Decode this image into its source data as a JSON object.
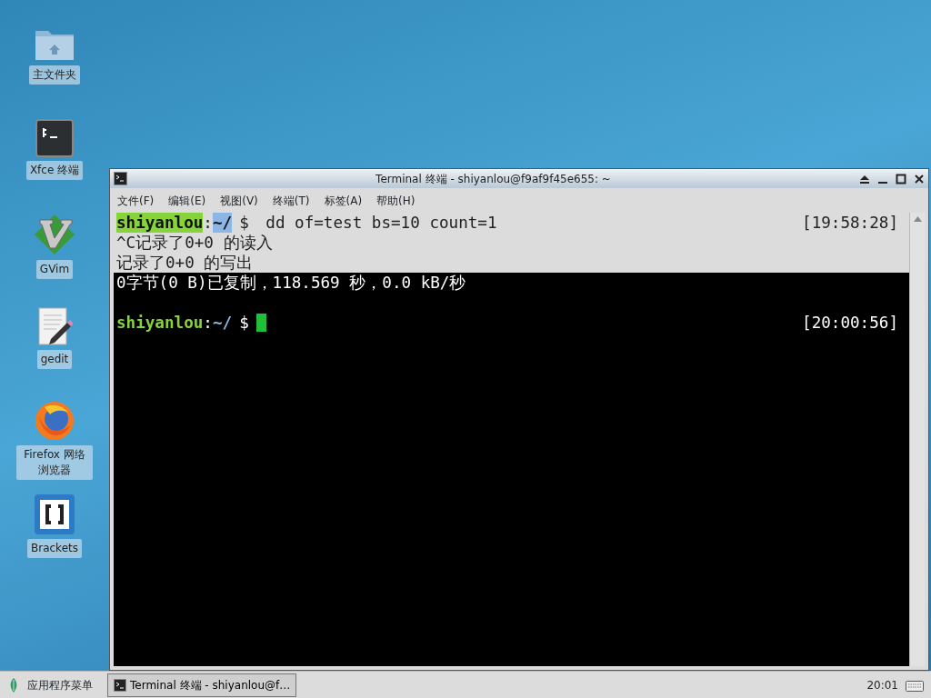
{
  "desktop_icons": [
    {
      "kind": "folder",
      "label": "主文件夹"
    },
    {
      "kind": "terminal",
      "label": "Xfce 终端"
    },
    {
      "kind": "vim",
      "label": "GVim"
    },
    {
      "kind": "editor",
      "label": "gedit"
    },
    {
      "kind": "browser",
      "label": "Firefox 网络浏览器"
    },
    {
      "kind": "brackets",
      "label": "Brackets"
    }
  ],
  "window": {
    "title": "Terminal 终端 - shiyanlou@f9af9f45e655: ~",
    "menu": [
      "文件(F)",
      "编辑(E)",
      "视图(V)",
      "终端(T)",
      "标签(A)",
      "帮助(H)"
    ],
    "lines": [
      {
        "kind": "prompt",
        "user": "shiyanlou",
        "sep": ":",
        "path": "~/",
        "symbol": "$",
        "command": " dd of=test bs=10 count=1",
        "time": "[19:58:28]",
        "selected": true,
        "cursor": false
      },
      {
        "kind": "output",
        "text": "^C记录了0+0 的读入",
        "selected": true
      },
      {
        "kind": "output",
        "text": "记录了0+0 的写出",
        "selected": true
      },
      {
        "kind": "output",
        "text": "0字节(0 B)已复制，118.569 秒，0.0 kB/秒",
        "selected": false
      },
      {
        "kind": "blank"
      },
      {
        "kind": "prompt",
        "user": "shiyanlou",
        "sep": ":",
        "path": "~/",
        "symbol": "$",
        "time": "[20:00:56]",
        "selected": false,
        "cursor": true
      }
    ]
  },
  "taskbar": {
    "menu_label": "应用程序菜单",
    "tasks": [
      {
        "label": "Terminal 终端 - shiyanlou@f…",
        "selected": true
      }
    ],
    "clock": "20:01"
  }
}
